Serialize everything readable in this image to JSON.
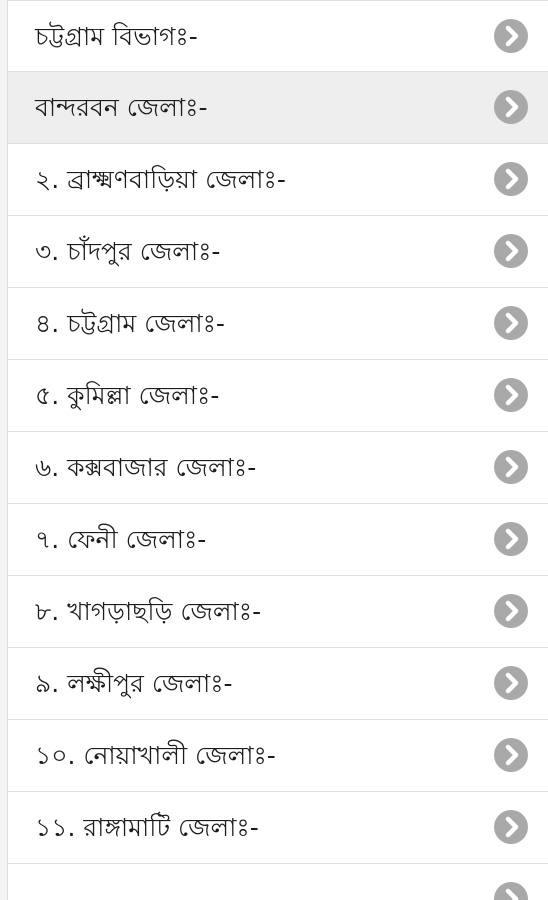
{
  "list": {
    "items": [
      {
        "label": "চট্টগ্রাম বিভাগঃ-",
        "active": false,
        "icon": "chevron-right-icon"
      },
      {
        "label": "বান্দরবন জেলাঃ-",
        "active": true,
        "icon": "chevron-right-icon"
      },
      {
        "label": "২. ব্রাক্ষ্মণবাড়িয়া জেলাঃ-",
        "active": false,
        "icon": "chevron-right-icon"
      },
      {
        "label": "৩. চাঁদপুর জেলাঃ-",
        "active": false,
        "icon": "chevron-right-icon"
      },
      {
        "label": "৪. চট্টগ্রাম জেলাঃ-",
        "active": false,
        "icon": "chevron-right-icon"
      },
      {
        "label": "৫. কুমিল্লা জেলাঃ-",
        "active": false,
        "icon": "chevron-right-icon"
      },
      {
        "label": "৬. কক্সবাজার জেলাঃ-",
        "active": false,
        "icon": "chevron-right-icon"
      },
      {
        "label": "৭. ফেনী জেলাঃ-",
        "active": false,
        "icon": "chevron-right-icon"
      },
      {
        "label": "৮. খাগড়াছড়ি জেলাঃ-",
        "active": false,
        "icon": "chevron-right-icon"
      },
      {
        "label": "৯. লক্ষীপুর জেলাঃ-",
        "active": false,
        "icon": "chevron-right-icon"
      },
      {
        "label": "১০. নোয়াখালী জেলাঃ-",
        "active": false,
        "icon": "chevron-right-icon"
      },
      {
        "label": "১১. রাঙ্গামাটি জেলাঃ-",
        "active": false,
        "icon": "chevron-right-icon"
      },
      {
        "label": "",
        "active": false,
        "icon": "chevron-right-icon"
      }
    ]
  },
  "colors": {
    "row_background": "#ffffff",
    "row_active_background": "#eeeeee",
    "divider": "#dedede",
    "text": "#1c1c1c",
    "chevron_circle": "#a9a9a9",
    "chevron_mark": "#ffffff"
  }
}
